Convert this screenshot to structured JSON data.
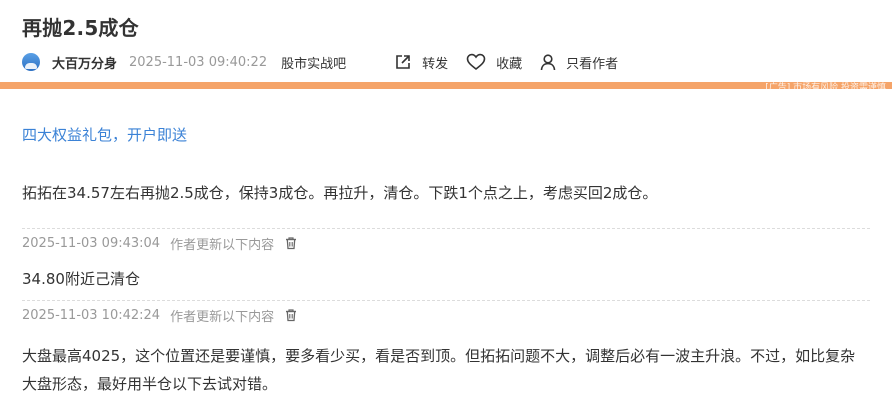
{
  "post": {
    "title": "再抛2.5成仓",
    "author": "大百万分身",
    "timestamp": "2025-11-03 09:40:22",
    "bar_name": "股市实战吧"
  },
  "actions": {
    "share_label": "转发",
    "favorite_label": "收藏",
    "only_author_label": "只看作者"
  },
  "banner": {
    "overlay_text": "[广告] 市场有风险 投资需谨慎",
    "color": "#f5a469"
  },
  "content": {
    "promo_link": "四大权益礼包，开户即送",
    "main_text": "拓拓在34.57左右再抛2.5成仓，保持3成仓。再拉升，清仓。下跌1个点之上，考虑买回2成仓。"
  },
  "updates": [
    {
      "timestamp": "2025-11-03 09:43:04",
      "note": "作者更新以下内容",
      "text": "34.80附近己清仓"
    },
    {
      "timestamp": "2025-11-03 10:42:24",
      "note": "作者更新以下内容",
      "text": "大盘最高4025，这个位置还是要谨慎，要多看少买，看是否到顶。但拓拓问题不大，调整后必有一波主升浪。不过，如比复杂大盘形态，最好用半仓以下去试对错。"
    }
  ],
  "colors": {
    "link_blue": "#3b82d6",
    "muted_gray": "#999999",
    "text_dark": "#333333"
  },
  "icons": {
    "share": "share-icon",
    "favorite": "heart-icon",
    "only_author": "user-icon",
    "delete": "trash-icon"
  }
}
